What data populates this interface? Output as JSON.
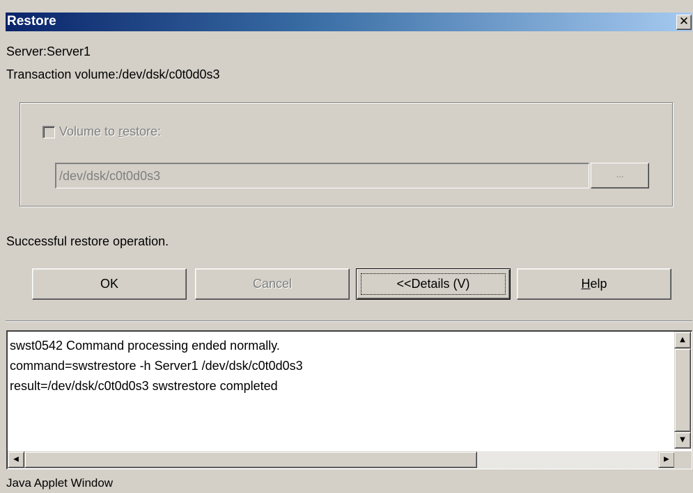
{
  "window": {
    "title": "Restore",
    "close_glyph": "✕"
  },
  "info": {
    "server": "Server:Server1",
    "transaction_volume": "Transaction volume:/dev/dsk/c0t0d0s3"
  },
  "restore_group": {
    "checkbox_label_pre": "Volume to ",
    "checkbox_label_mnemonic": "r",
    "checkbox_label_post": "estore:",
    "checkbox_checked": false,
    "volume_value": "/dev/dsk/c0t0d0s3",
    "browse_label": "..."
  },
  "status_message": "Successful restore operation.",
  "buttons": {
    "ok": "OK",
    "cancel": "Cancel",
    "details": "<<Details  (V)",
    "help_mnemonic": "H",
    "help_rest": "elp"
  },
  "log": {
    "lines": [
      "swst0542 Command processing ended normally.",
      "command=swstrestore -h Server1 /dev/dsk/c0t0d0s3",
      "result=/dev/dsk/c0t0d0s3 swstrestore completed"
    ]
  },
  "scroll_icons": {
    "up": "▲",
    "down": "▼",
    "left": "◀",
    "right": "▶"
  },
  "footer": "Java Applet Window",
  "colors": {
    "title_start": "#0a246a",
    "title_end": "#a6caf0",
    "face": "#d4d0c8",
    "disabled_text": "#808080"
  }
}
